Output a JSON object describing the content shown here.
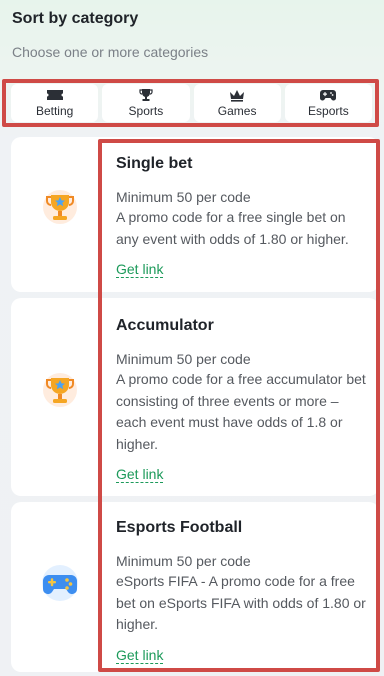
{
  "header": {
    "title": "Sort by category",
    "subtitle": "Choose one or more categories"
  },
  "categories": [
    {
      "label": "Betting",
      "icon": "ticket-icon"
    },
    {
      "label": "Sports",
      "icon": "trophy-icon"
    },
    {
      "label": "Games",
      "icon": "crown-icon"
    },
    {
      "label": "Esports",
      "icon": "gamepad-icon"
    }
  ],
  "promos": [
    {
      "title": "Single bet",
      "minimum": "Minimum 50 per code",
      "description": "A promo code for a free single bet on any event with odds of 1.80 or higher.",
      "link": "Get link",
      "icon": "trophy-icon"
    },
    {
      "title": "Accumulator",
      "minimum": "Minimum 50 per code",
      "description": "A promo code for a free accumulator bet consisting of three events or more – each event must have odds of 1.8 or higher.",
      "link": "Get link",
      "icon": "trophy-icon"
    },
    {
      "title": "Esports Football",
      "minimum": "Minimum 50 per code",
      "description": "eSports FIFA - A promo code for a free bet on eSports FIFA with odds of 1.80 or higher.",
      "link": "Get link",
      "icon": "gamepad-icon"
    }
  ],
  "colors": {
    "accent_link": "#1c9a5a",
    "highlight_frame": "#cf4a46",
    "trophy": "#f5a623",
    "gamepad": "#3d8ef0"
  }
}
